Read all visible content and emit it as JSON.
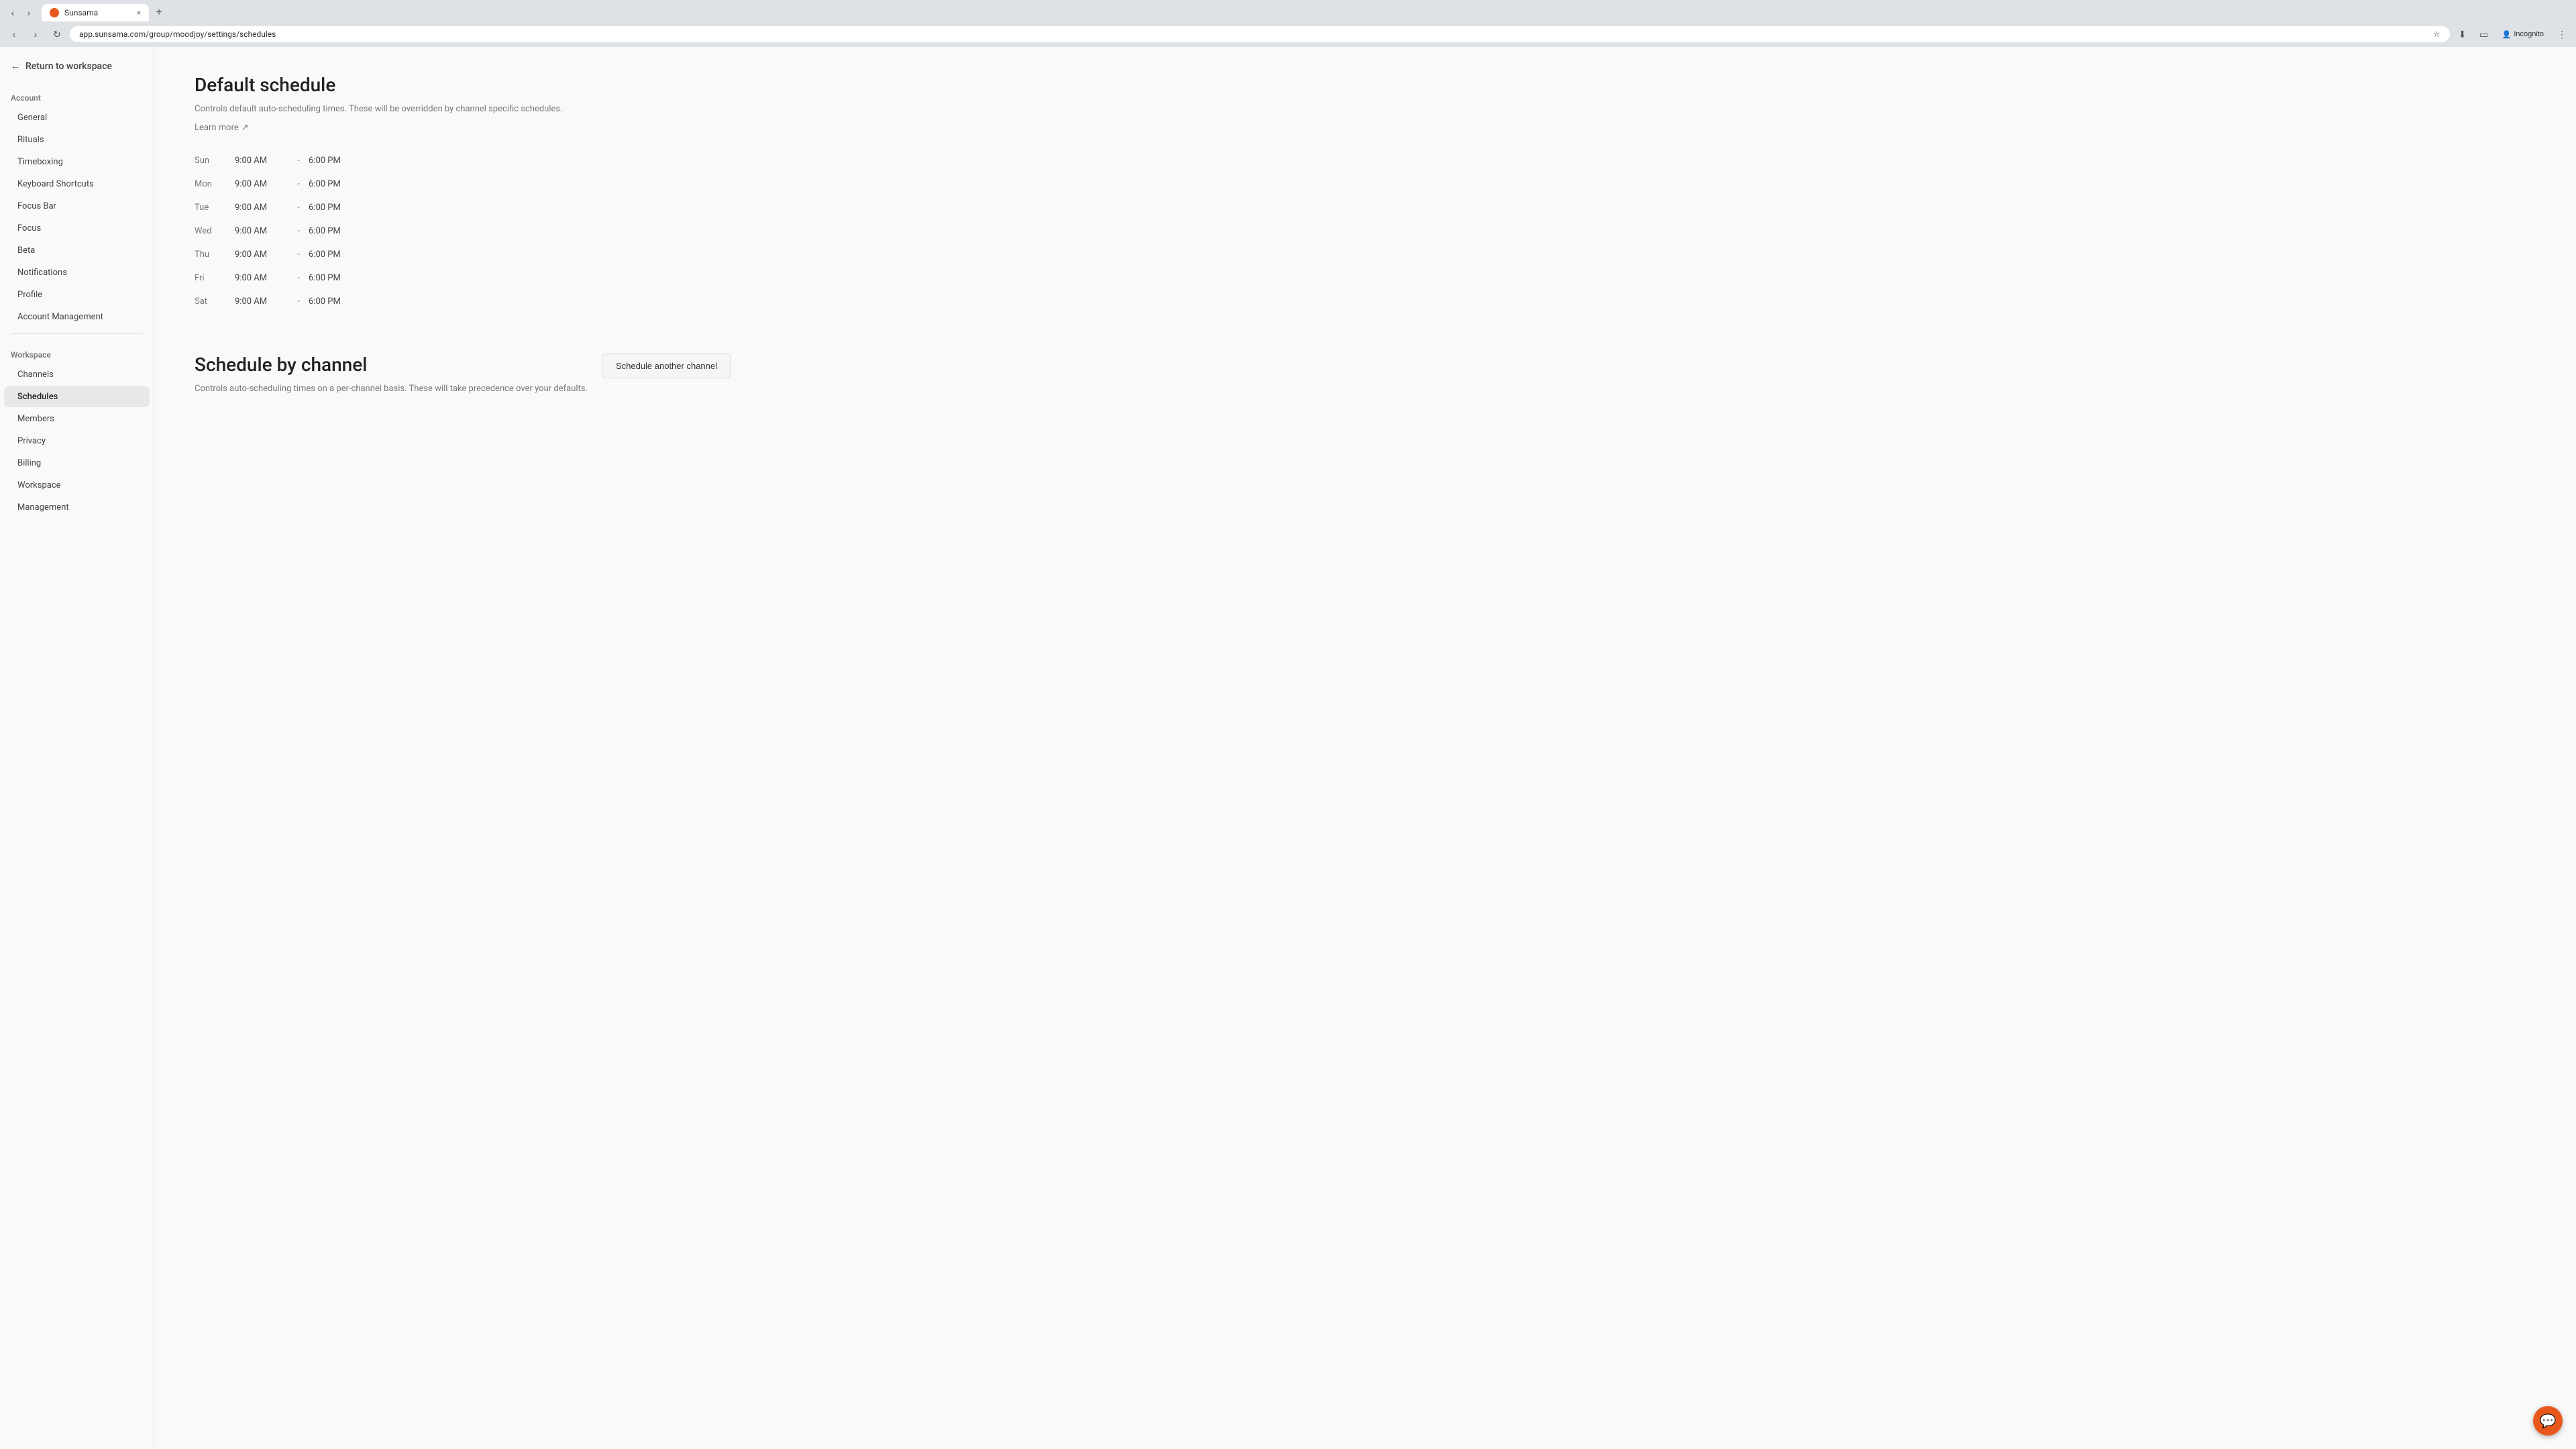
{
  "browser": {
    "tab_favicon": "sunsama-favicon",
    "tab_title": "Sunsama",
    "tab_close": "×",
    "new_tab": "+",
    "url": "app.sunsama.com/group/moodjoy/settings/schedules",
    "nav_back": "‹",
    "nav_forward": "›",
    "nav_refresh": "↻",
    "bookmark_icon": "☆",
    "download_icon": "⬇",
    "tab_manager_icon": "▭",
    "profile_label": "Incognito",
    "menu_icon": "⋮"
  },
  "sidebar": {
    "return_label": "Return to workspace",
    "account_section": "Account",
    "account_items": [
      {
        "id": "general",
        "label": "General"
      },
      {
        "id": "rituals",
        "label": "Rituals"
      },
      {
        "id": "timeboxing",
        "label": "Timeboxing"
      },
      {
        "id": "keyboard-shortcuts",
        "label": "Keyboard Shortcuts"
      },
      {
        "id": "focus-bar",
        "label": "Focus Bar"
      },
      {
        "id": "focus",
        "label": "Focus"
      },
      {
        "id": "beta",
        "label": "Beta"
      },
      {
        "id": "notifications",
        "label": "Notifications"
      },
      {
        "id": "profile",
        "label": "Profile"
      },
      {
        "id": "account-management",
        "label": "Account Management"
      }
    ],
    "workspace_section": "Workspace",
    "workspace_items": [
      {
        "id": "channels",
        "label": "Channels"
      },
      {
        "id": "schedules",
        "label": "Schedules",
        "active": true
      },
      {
        "id": "members",
        "label": "Members"
      },
      {
        "id": "privacy",
        "label": "Privacy"
      },
      {
        "id": "billing",
        "label": "Billing"
      },
      {
        "id": "workspace",
        "label": "Workspace"
      },
      {
        "id": "management",
        "label": "Management"
      }
    ]
  },
  "main": {
    "default_schedule": {
      "title": "Default schedule",
      "description": "Controls default auto-scheduling times. These will be overridden by channel specific schedules.",
      "learn_more_label": "Learn more",
      "learn_more_icon": "↗",
      "schedule_rows": [
        {
          "day": "Sun",
          "start": "9:00 AM",
          "sep": "-",
          "end": "6:00 PM"
        },
        {
          "day": "Mon",
          "start": "9:00 AM",
          "sep": "-",
          "end": "6:00 PM"
        },
        {
          "day": "Tue",
          "start": "9:00 AM",
          "sep": "-",
          "end": "6:00 PM"
        },
        {
          "day": "Wed",
          "start": "9:00 AM",
          "sep": "-",
          "end": "6:00 PM"
        },
        {
          "day": "Thu",
          "start": "9:00 AM",
          "sep": "-",
          "end": "6:00 PM"
        },
        {
          "day": "Fri",
          "start": "9:00 AM",
          "sep": "-",
          "end": "6:00 PM"
        },
        {
          "day": "Sat",
          "start": "9:00 AM",
          "sep": "-",
          "end": "6:00 PM"
        }
      ]
    },
    "schedule_by_channel": {
      "title": "Schedule by channel",
      "description": "Controls auto-scheduling times on a per-channel basis. These will take precedence over your defaults.",
      "button_label": "Schedule another channel"
    }
  },
  "chat": {
    "icon": "💬"
  }
}
